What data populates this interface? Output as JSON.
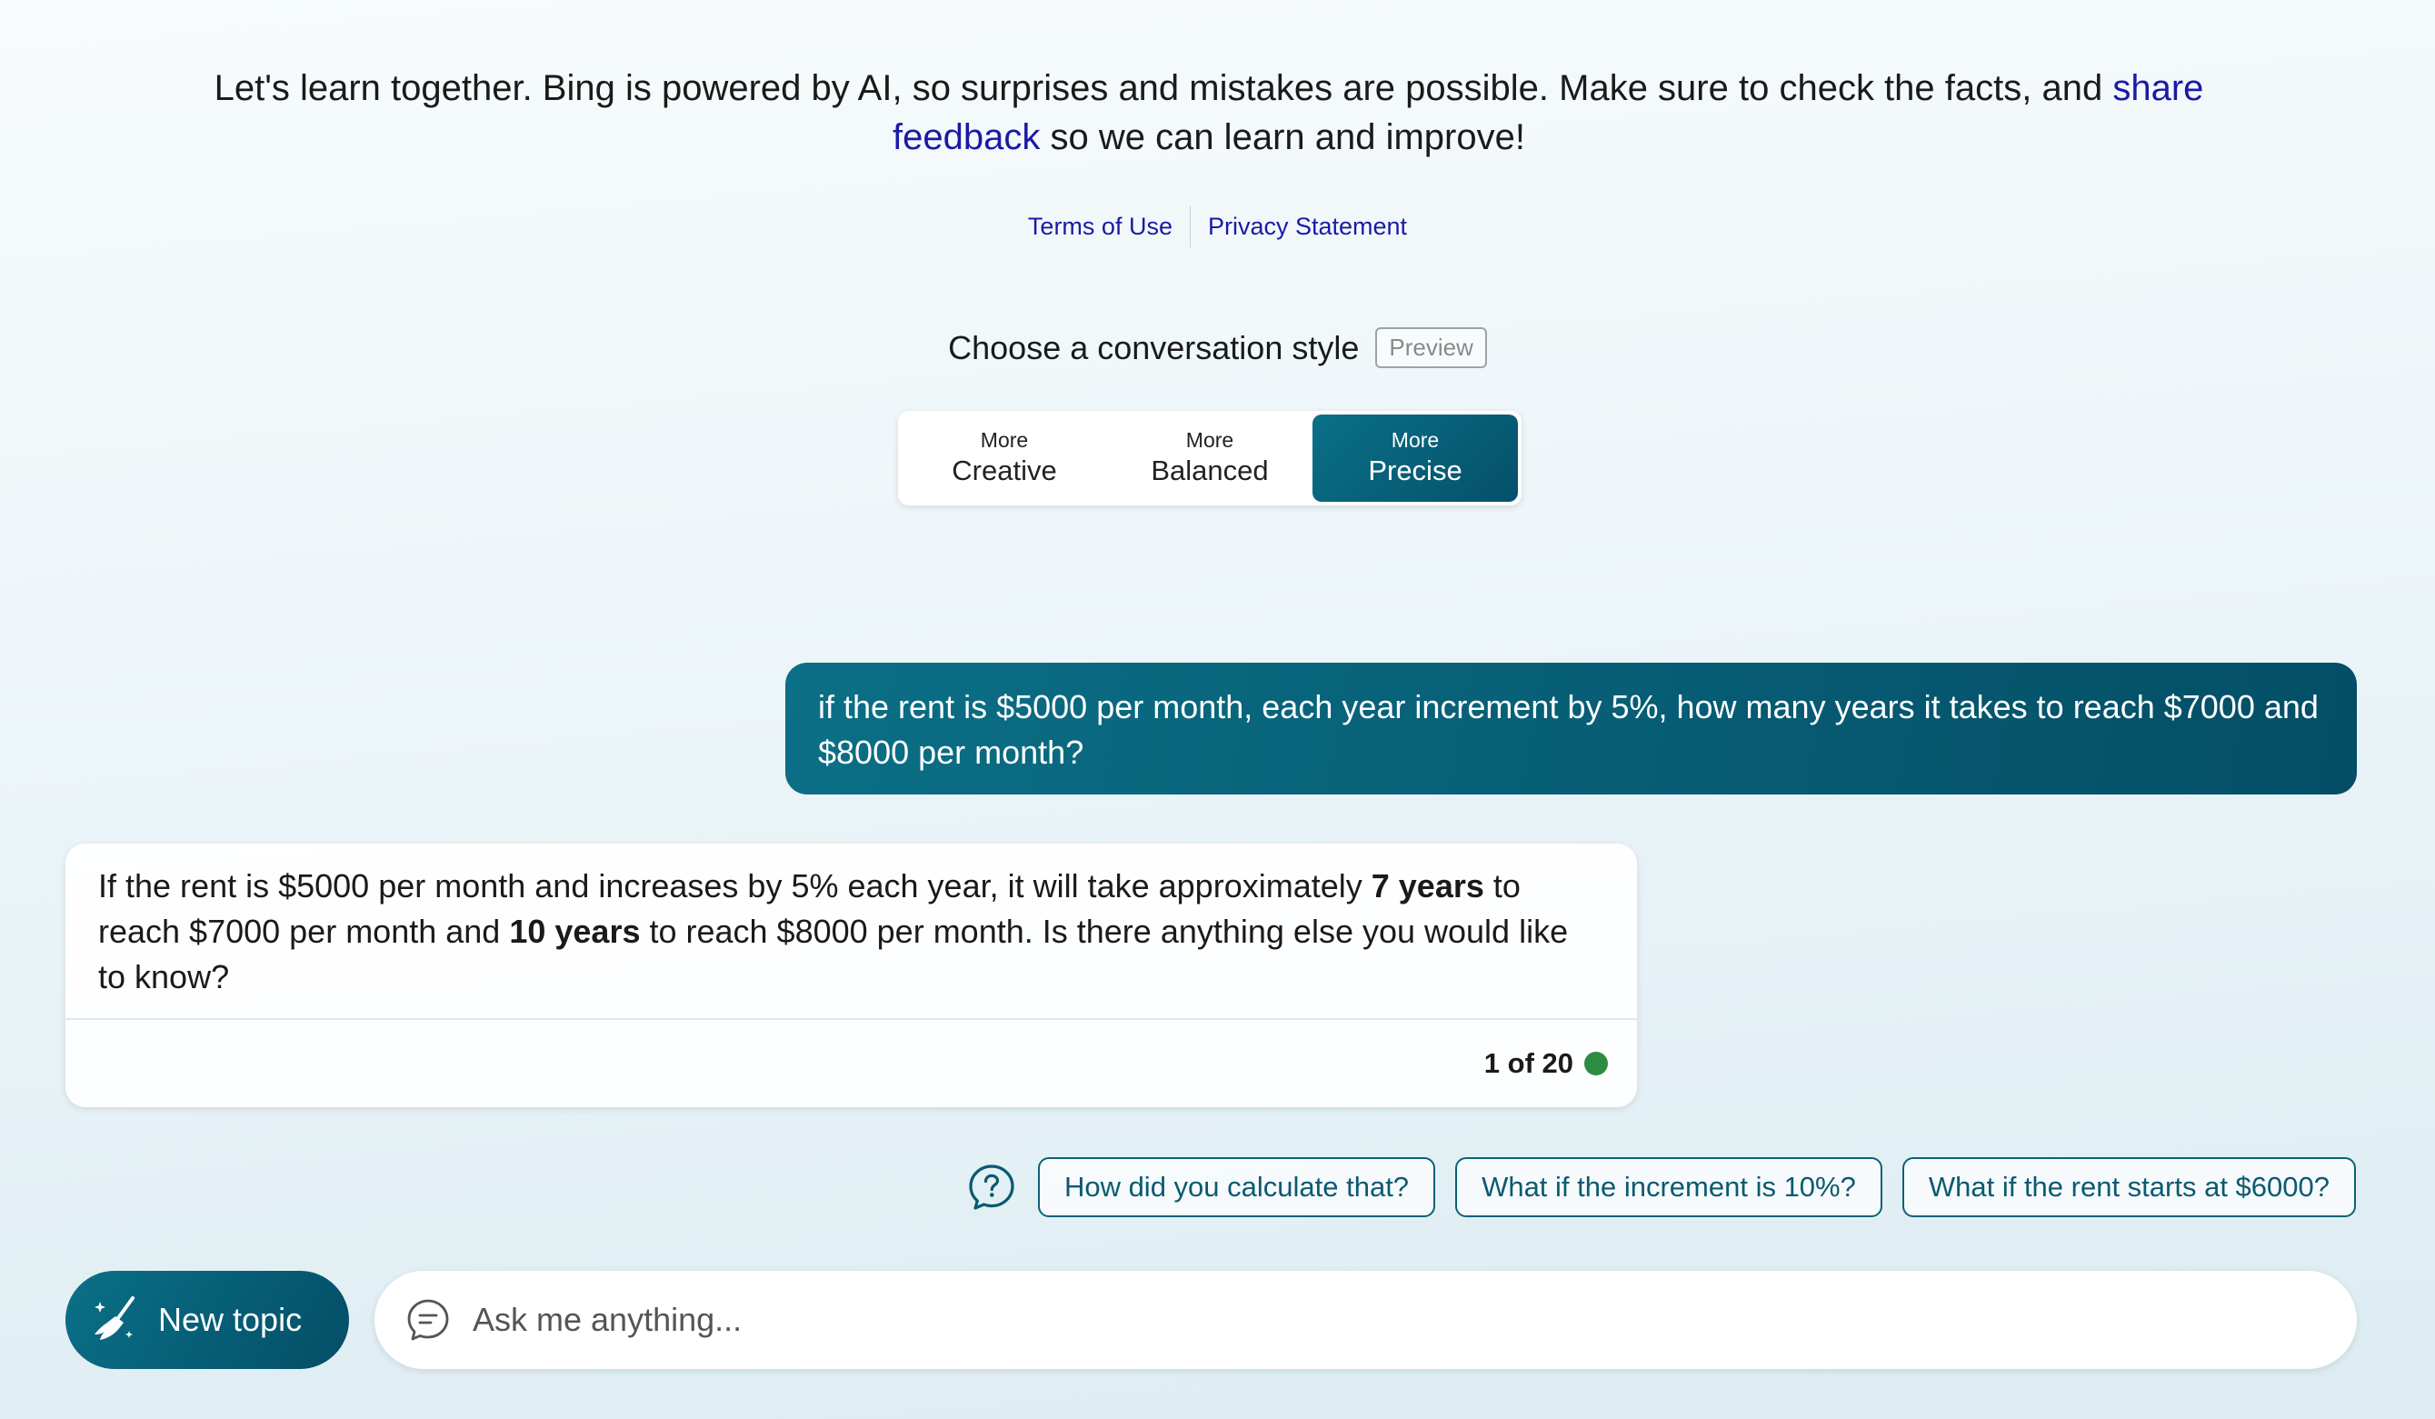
{
  "disclaimer": {
    "before": "Let's learn together. Bing is powered by AI, so surprises and mistakes are possible. Make sure to check the facts, and ",
    "link": "share feedback",
    "after": " so we can learn and improve!"
  },
  "links": {
    "terms": "Terms of Use",
    "privacy": "Privacy Statement"
  },
  "style_picker": {
    "heading": "Choose a conversation style",
    "badge": "Preview",
    "options": [
      {
        "small": "More",
        "label": "Creative",
        "active": false
      },
      {
        "small": "More",
        "label": "Balanced",
        "active": false
      },
      {
        "small": "More",
        "label": "Precise",
        "active": true
      }
    ]
  },
  "conversation": {
    "user_message": "if the rent is $5000 per month, each year increment by 5%, how many years it takes to reach $7000 and $8000 per month?",
    "bot_message": {
      "part1": "If the rent is $5000 per month and increases by 5% each year, it will take approximately ",
      "bold1": "7 years",
      "part2": " to reach $7000 per month and ",
      "bold2": "10 years",
      "part3": " to reach $8000 per month. Is there anything else you would like to know?"
    },
    "turn_counter": "1 of 20",
    "status_color": "#2e8b42"
  },
  "suggestions": [
    "How did you calculate that?",
    "What if the increment is 10%?",
    "What if the rent starts at $6000?"
  ],
  "composer": {
    "new_topic_label": "New topic",
    "placeholder": "Ask me anything..."
  },
  "colors": {
    "accent": "#05506a",
    "link": "#1a1aa6"
  }
}
